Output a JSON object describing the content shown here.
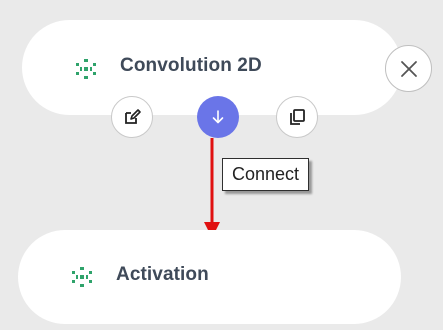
{
  "nodes": {
    "convolution": {
      "label": "Convolution 2D",
      "icon": "network-icon"
    },
    "activation": {
      "label": "Activation",
      "icon": "network-icon"
    }
  },
  "actions": {
    "edit_icon": "edit-icon",
    "connect_icon": "arrow-down-icon",
    "copy_icon": "copy-icon",
    "close_icon": "close-icon"
  },
  "tooltip": {
    "text": "Connect"
  },
  "colors": {
    "background": "#eaeaea",
    "node_fill": "#ffffff",
    "label_text": "#3f4a59",
    "icon_green": "#2fa36b",
    "connect_button": "#6a75e8",
    "connection_arrow": "#e01010"
  }
}
